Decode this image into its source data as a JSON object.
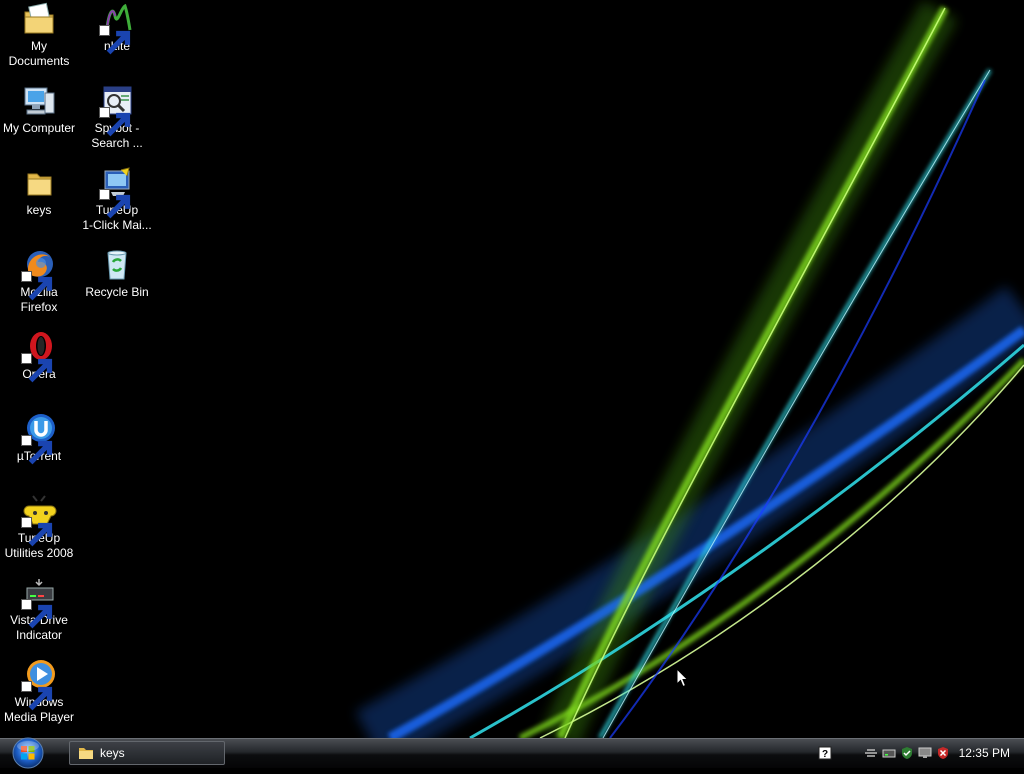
{
  "desktop": {
    "icons": [
      {
        "label": "My\nDocuments",
        "icon": "my-documents-icon"
      },
      {
        "label": "My Computer",
        "icon": "computer-icon"
      },
      {
        "label": "keys",
        "icon": "folder-icon"
      },
      {
        "label": "Mozilla\nFirefox",
        "icon": "firefox-icon"
      },
      {
        "label": "Opera",
        "icon": "opera-icon"
      },
      {
        "label": "µTorrent",
        "icon": "utorrent-icon"
      },
      {
        "label": "TuneUp\nUtilities 2008",
        "icon": "tuneup-utilities-icon"
      },
      {
        "label": "Vista Drive\nIndicator",
        "icon": "drive-indicator-icon"
      },
      {
        "label": "Windows\nMedia Player",
        "icon": "media-player-icon"
      },
      {
        "label": "nLite",
        "icon": "nlite-icon"
      },
      {
        "label": "Spybot -\nSearch ...",
        "icon": "spybot-icon"
      },
      {
        "label": "TuneUp\n1-Click Mai...",
        "icon": "tuneup-1click-icon"
      },
      {
        "label": "Recycle Bin",
        "icon": "recycle-bin-icon"
      }
    ]
  },
  "taskbar": {
    "start_icon": "windows-orb-icon",
    "tasks": [
      {
        "label": "keys",
        "icon": "folder-icon"
      }
    ],
    "tray_icons": [
      "help-icon",
      "network-icon",
      "drive-icon",
      "shield-check-icon",
      "monitor-icon",
      "security-alert-icon"
    ],
    "clock": "12:35 PM"
  },
  "colors": {
    "wallpaper_green": "#7bd41a",
    "wallpaper_cyan": "#2fd6e0",
    "wallpaper_blue": "#1a3cff",
    "taskbar_dark": "#0c0d0f"
  }
}
